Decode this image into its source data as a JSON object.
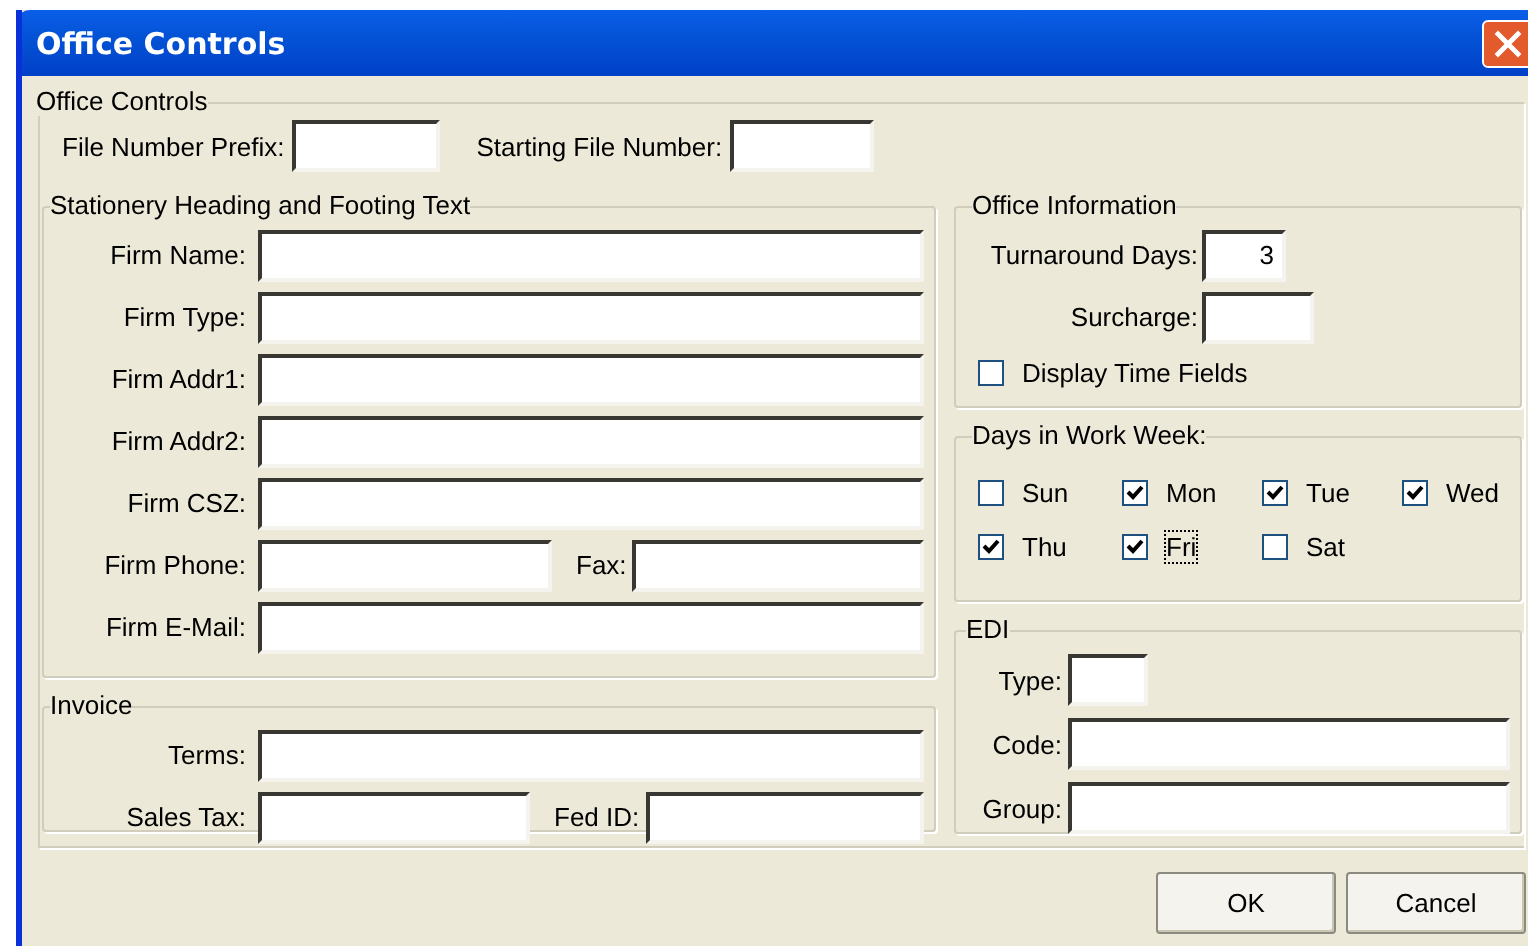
{
  "window": {
    "title": "Office Controls"
  },
  "office_controls": {
    "legend": "Office Controls",
    "fields": [
      {
        "label": "File Number Prefix:"
      },
      {
        "label": "Starting File Number:"
      }
    ]
  },
  "stationery": {
    "legend": "Stationery Heading and Footing Text",
    "rows": [
      [
        {
          "label": "Firm Name:"
        }
      ],
      [
        {
          "label": "Firm Type:"
        }
      ],
      [
        {
          "label": "Firm Addr1:"
        }
      ],
      [
        {
          "label": "Firm Addr2:"
        }
      ],
      [
        {
          "label": "Firm CSZ:"
        }
      ],
      [
        {
          "label": "Firm Phone:"
        },
        {
          "label": "Fax:"
        }
      ],
      [
        {
          "label": "Firm E-Mail:"
        }
      ]
    ]
  },
  "invoice": {
    "legend": "Invoice",
    "rows": [
      [
        {
          "label": "Terms:"
        }
      ],
      [
        {
          "label": "Sales Tax:"
        },
        {
          "label": "Fed ID:"
        }
      ]
    ]
  },
  "office_information": {
    "legend": "Office Information",
    "fields": [
      {
        "label": "Turnaround Days:",
        "value": "3"
      },
      {
        "label": "Surcharge:"
      }
    ],
    "checkbox": {
      "label": "Display Time Fields",
      "checked": false
    }
  },
  "work_week": {
    "legend": "Days in Work Week:",
    "days": [
      {
        "label": "Sun",
        "checked": false,
        "focused": false
      },
      {
        "label": "Mon",
        "checked": true,
        "focused": false
      },
      {
        "label": "Tue",
        "checked": true,
        "focused": false
      },
      {
        "label": "Wed",
        "checked": true,
        "focused": false
      },
      {
        "label": "Thu",
        "checked": true,
        "focused": false
      },
      {
        "label": "Fri",
        "checked": true,
        "focused": true
      },
      {
        "label": "Sat",
        "checked": false,
        "focused": false
      }
    ]
  },
  "edi": {
    "legend": "EDI",
    "fields": [
      {
        "label": "Type:"
      },
      {
        "label": "Code:"
      },
      {
        "label": "Group:"
      }
    ]
  },
  "buttons": [
    {
      "label": "OK"
    },
    {
      "label": "Cancel"
    }
  ]
}
